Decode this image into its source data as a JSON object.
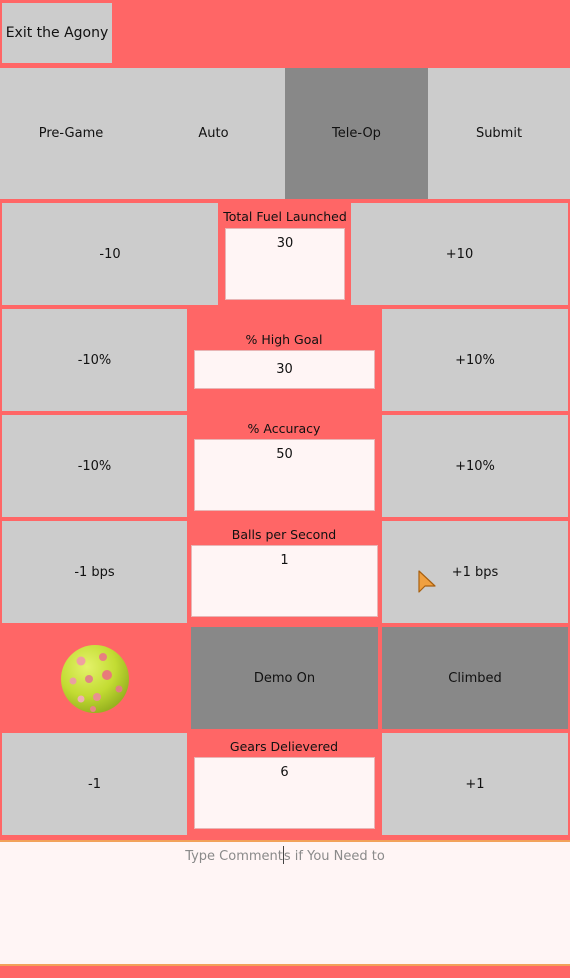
{
  "header": {
    "exit_label": "Exit the Agony"
  },
  "tabs": [
    {
      "label": "Pre-Game",
      "active": false
    },
    {
      "label": "Auto",
      "active": false
    },
    {
      "label": "Tele-Op",
      "active": true
    },
    {
      "label": "Submit",
      "active": false
    }
  ],
  "fuel": {
    "minus_label": "-10",
    "title": "Total Fuel Launched",
    "value": "30",
    "plus_label": "+10"
  },
  "high_goal": {
    "minus_label": "-10%",
    "title": "% High Goal",
    "value": "30",
    "plus_label": "+10%"
  },
  "accuracy": {
    "minus_label": "-10%",
    "title": "% Accuracy",
    "value": "50",
    "plus_label": "+10%"
  },
  "bps": {
    "minus_label": "-1 bps",
    "title": "Balls per Second",
    "value": "1",
    "plus_label": "+1 bps"
  },
  "toggles": {
    "demo_label": "Demo On",
    "climbed_label": "Climbed",
    "ball_icon": "wiffle-ball-icon"
  },
  "gears": {
    "minus_label": "-1",
    "title": "Gears Delievered",
    "value": "6",
    "plus_label": "+1"
  },
  "comments": {
    "placeholder_before": "Type Comment",
    "placeholder_after": "s if You Need to"
  },
  "colors": {
    "background": "#ff6666",
    "button": "#cccccc",
    "button_active": "#888888",
    "field": "#fff5f5",
    "ball": "#c7e03a"
  }
}
